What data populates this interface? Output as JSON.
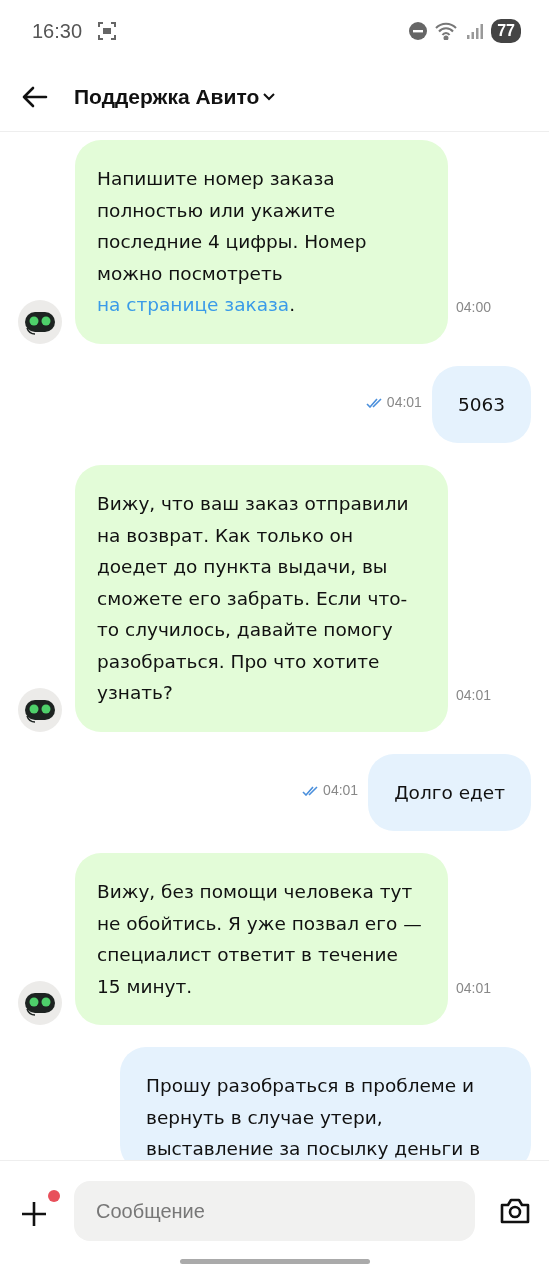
{
  "status_bar": {
    "time": "16:30",
    "battery": "77"
  },
  "header": {
    "title": "Поддержка Авито"
  },
  "messages": [
    {
      "kind": "incoming",
      "text": "Напишите номер заказа полностью или укажите последние 4 цифры. Номер можно посмотреть ",
      "link": "на странице заказа",
      "after": ".",
      "time": "04:00"
    },
    {
      "kind": "outgoing",
      "text": "5063",
      "time": "04:01",
      "read": true
    },
    {
      "kind": "incoming",
      "text": "Вижу, что ваш заказ отправили на возврат. Как только он доедет до пункта выдачи, вы сможете его забрать. Если что-то случилось, давайте помогу разобраться. Про что хотите узнать?",
      "time": "04:01"
    },
    {
      "kind": "outgoing",
      "text": "Долго едет",
      "time": "04:01",
      "read": true
    },
    {
      "kind": "incoming",
      "text": "Вижу, без помощи человека тут не обойтись. Я уже позвал его — специалист ответит в течение 15 минут.",
      "time": "04:01"
    },
    {
      "kind": "outgoing",
      "text": "Прошу разобраться в проблеме и вернуть в случае утери, выставление за посылку деньги в"
    }
  ],
  "composer": {
    "placeholder": "Сообщение",
    "attach_badge": true
  }
}
